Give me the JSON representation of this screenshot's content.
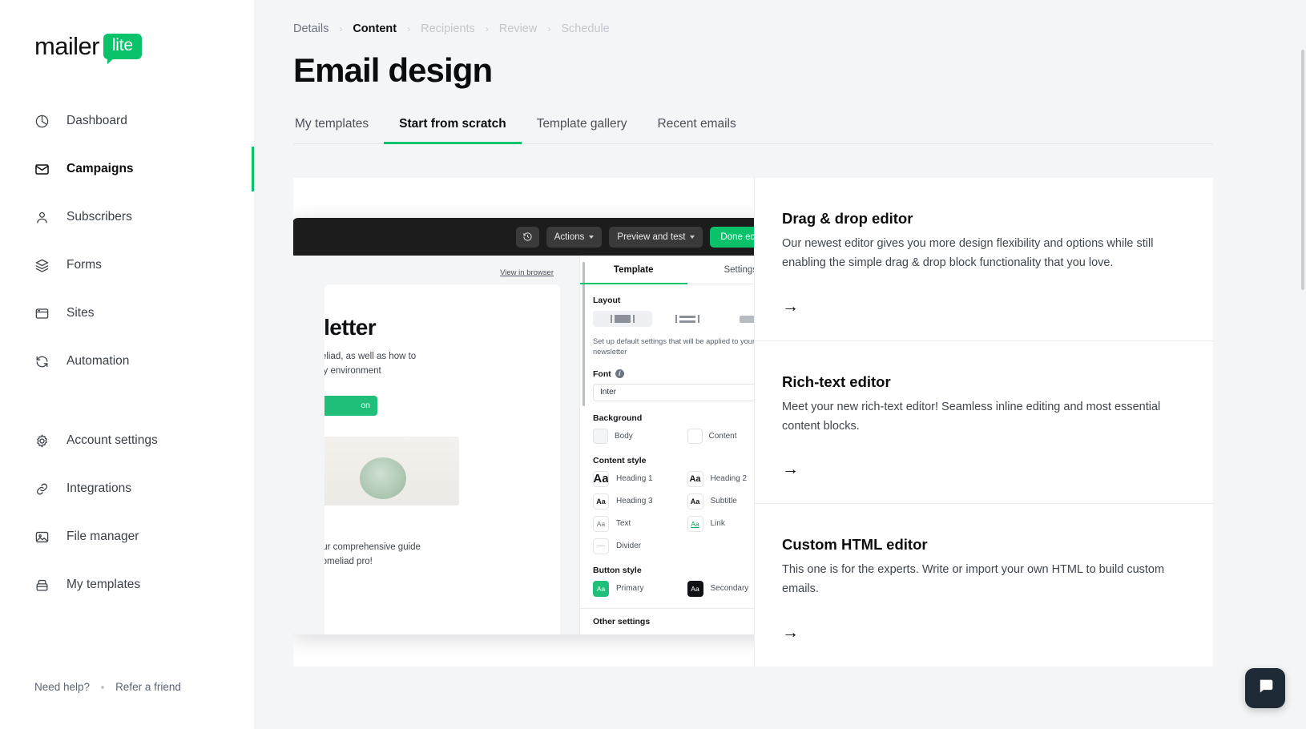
{
  "brand": {
    "logo_text": "mailer",
    "logo_badge": "lite",
    "accent_color": "#09c269",
    "dark_color": "#1c1c1c"
  },
  "sidebar": {
    "groups": [
      {
        "items": [
          {
            "label": "Dashboard",
            "icon": "pie-chart-icon",
            "active": false
          },
          {
            "label": "Campaigns",
            "icon": "envelope-icon",
            "active": true
          },
          {
            "label": "Subscribers",
            "icon": "user-icon",
            "active": false
          },
          {
            "label": "Forms",
            "icon": "layers-icon",
            "active": false
          },
          {
            "label": "Sites",
            "icon": "browser-window-icon",
            "active": false
          },
          {
            "label": "Automation",
            "icon": "refresh-icon",
            "active": false
          }
        ]
      },
      {
        "items": [
          {
            "label": "Account settings",
            "icon": "gear-icon",
            "active": false
          },
          {
            "label": "Integrations",
            "icon": "link-icon",
            "active": false
          },
          {
            "label": "File manager",
            "icon": "image-icon",
            "active": false
          },
          {
            "label": "My templates",
            "icon": "template-icon",
            "active": false
          }
        ]
      }
    ],
    "footer": {
      "help": "Need help?",
      "refer": "Refer a friend"
    }
  },
  "header": {
    "breadcrumb": [
      {
        "label": "Details",
        "state": "done"
      },
      {
        "label": "Content",
        "state": "current"
      },
      {
        "label": "Recipients",
        "state": "upcoming"
      },
      {
        "label": "Review",
        "state": "upcoming"
      },
      {
        "label": "Schedule",
        "state": "upcoming"
      }
    ],
    "separator": "›",
    "title": "Email design"
  },
  "tabs": [
    {
      "label": "My templates",
      "active": false
    },
    {
      "label": "Start from scratch",
      "active": true
    },
    {
      "label": "Template gallery",
      "active": false
    },
    {
      "label": "Recent emails",
      "active": false
    }
  ],
  "editor_preview": {
    "toolbar": {
      "history_icon": "history-icon",
      "actions": "Actions",
      "preview_and_test": "Preview and test",
      "done_editing": "Done editing"
    },
    "email": {
      "view_in_browser": "View in browser",
      "heading": "ewsletter",
      "paragraph_line1": "ngs bromeliad, as well as how to",
      "paragraph_line2": "nts in a dry environment",
      "button_label": "on",
      "paragraph2_line1": "elming. Our comprehensive guide",
      "paragraph2_line2": "to be a bromeliad pro!"
    },
    "panel": {
      "tabs": [
        {
          "label": "Template",
          "active": true
        },
        {
          "label": "Settings",
          "active": false
        }
      ],
      "layout_label": "Layout",
      "layout_options": [
        "single-column",
        "split-column",
        "full-width"
      ],
      "note": "Set up default settings that will be applied to your whole newsletter",
      "font_label": "Font",
      "font_value": "Inter",
      "background_label": "Background",
      "background_options": [
        {
          "label": "Body",
          "color": "#f4f5f7"
        },
        {
          "label": "Content",
          "color": "#ffffff"
        }
      ],
      "content_style_label": "Content style",
      "content_styles": [
        {
          "label": "Heading 1",
          "sample": "Aa",
          "variant": "h1"
        },
        {
          "label": "Heading 2",
          "sample": "Aa",
          "variant": "h2"
        },
        {
          "label": "Heading 3",
          "sample": "Aa",
          "variant": "h3"
        },
        {
          "label": "Subtitle",
          "sample": "Aa",
          "variant": "sub"
        },
        {
          "label": "Text",
          "sample": "Aa",
          "variant": "txt"
        },
        {
          "label": "Link",
          "sample": "Aa",
          "variant": "link"
        },
        {
          "label": "Divider",
          "sample": "—",
          "variant": "div"
        }
      ],
      "button_style_label": "Button style",
      "button_styles": [
        {
          "label": "Primary",
          "sample": "Aa",
          "color": "#1fbf7a"
        },
        {
          "label": "Secondary",
          "sample": "Aa",
          "color": "#101114"
        }
      ],
      "other_settings": "Other settings"
    }
  },
  "options": [
    {
      "title": "Drag & drop editor",
      "description": "Our newest editor gives you more design flexibility and options while still enabling the simple drag & drop block functionality that you love.",
      "arrow": "→"
    },
    {
      "title": "Rich-text editor",
      "description": "Meet your new rich-text editor! Seamless inline editing and most essential content blocks.",
      "arrow": "→"
    },
    {
      "title": "Custom HTML editor",
      "description": "This one is for the experts. Write or import your own HTML to build custom emails.",
      "arrow": "→"
    }
  ]
}
